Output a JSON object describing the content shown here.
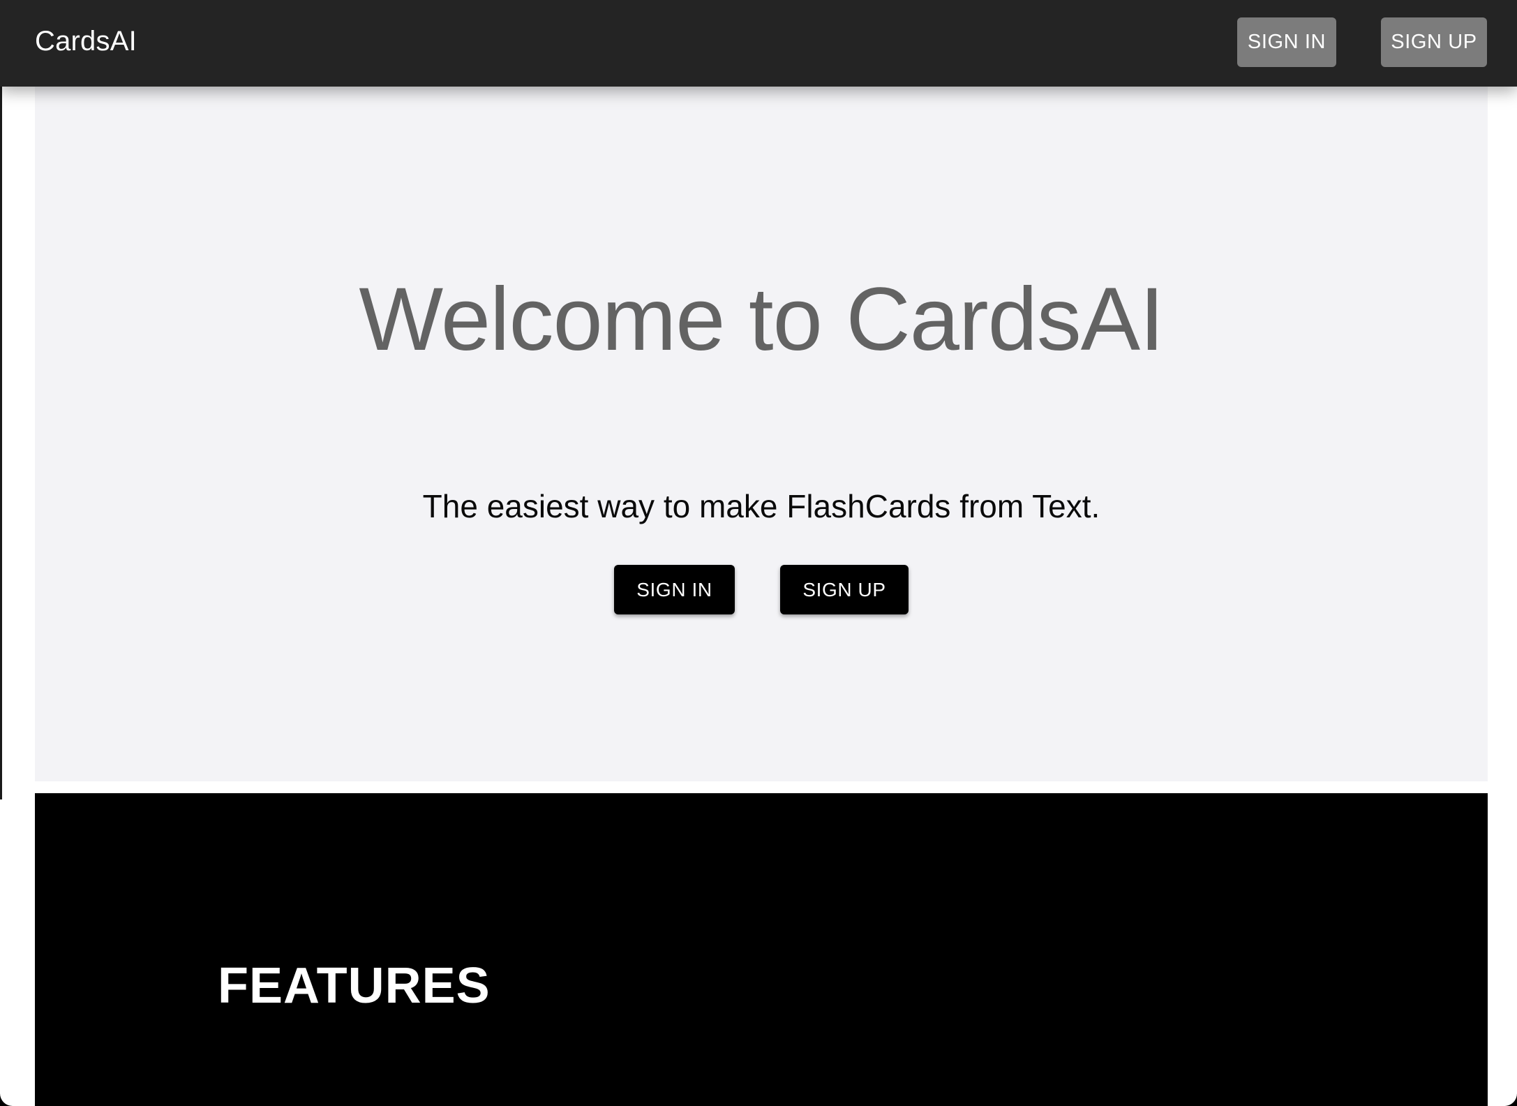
{
  "appbar": {
    "brand": "CardsAI",
    "sign_in_label": "SIGN IN",
    "sign_up_label": "SIGN UP"
  },
  "hero": {
    "title": "Welcome to CardsAI",
    "subtitle": "The easiest way to make FlashCards from Text.",
    "sign_in_label": "SIGN IN",
    "sign_up_label": "SIGN UP"
  },
  "features": {
    "title": "FEATURES"
  },
  "colors": {
    "appbar_bg": "#242424",
    "nav_button_bg": "#7c7c7c",
    "hero_bg": "#f3f3f6",
    "hero_title": "#636363",
    "primary_button_bg": "#000000",
    "features_bg": "#000000"
  }
}
